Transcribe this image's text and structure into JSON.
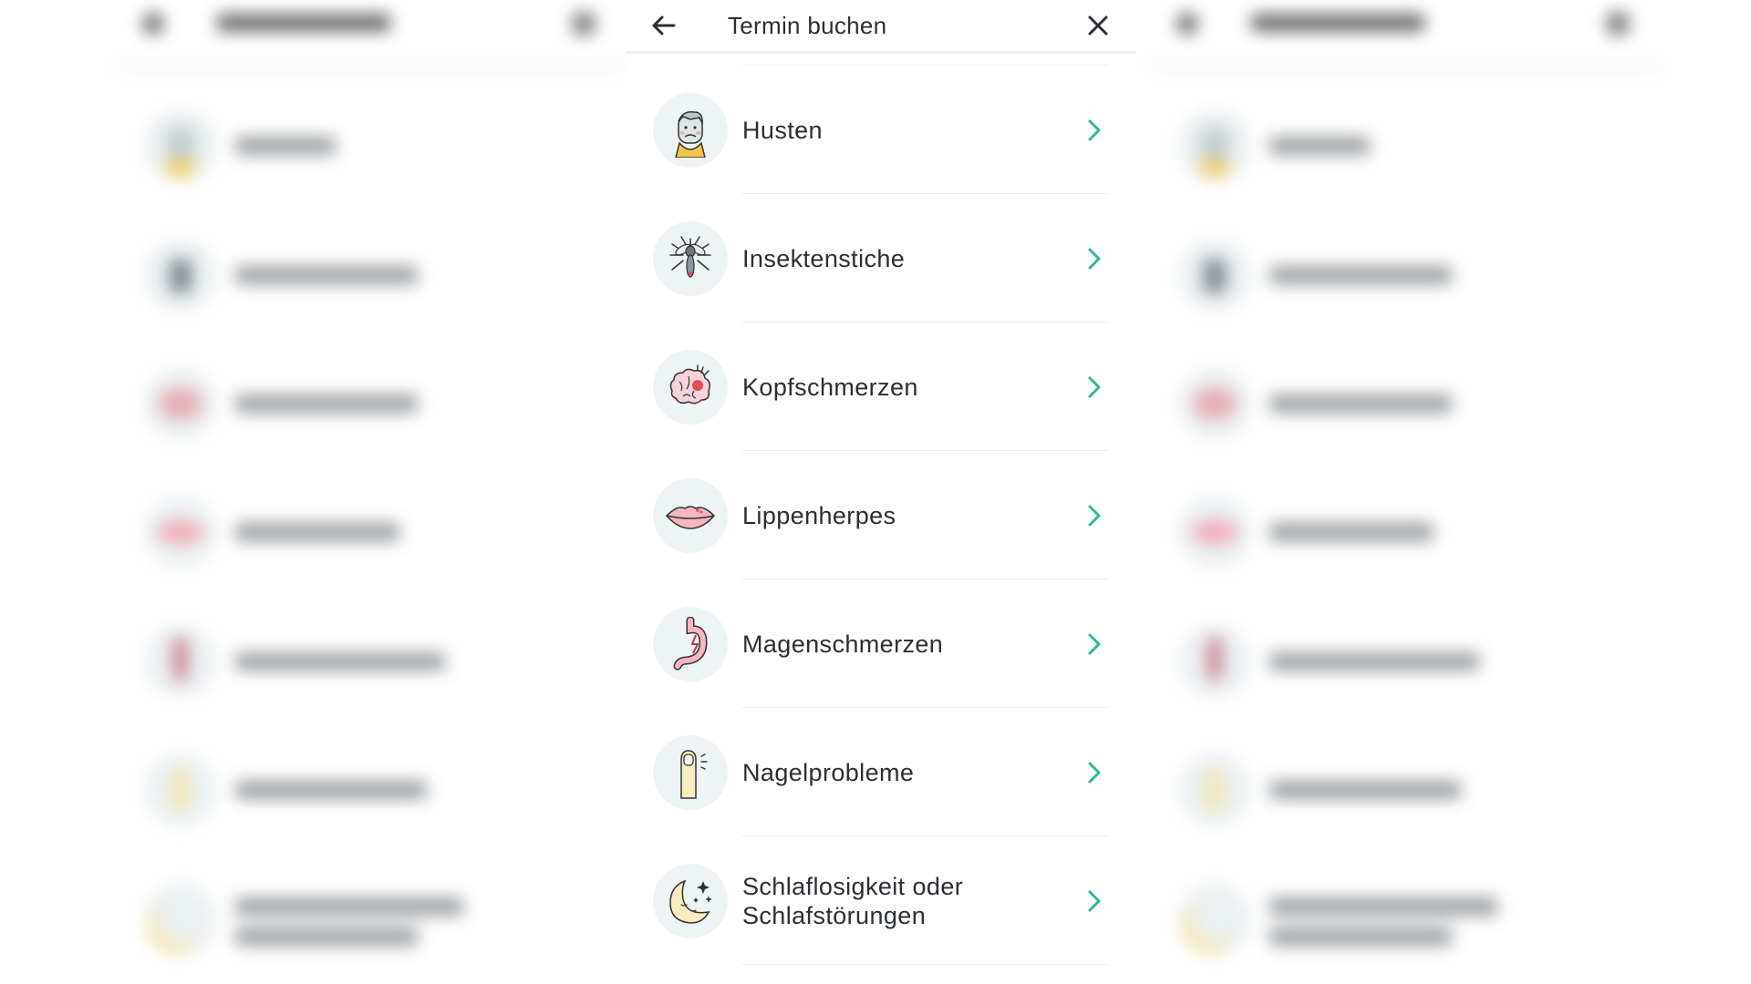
{
  "header": {
    "title": "Termin buchen",
    "back_icon": "arrow-left-icon",
    "close_icon": "close-icon"
  },
  "colors": {
    "accent": "#2fb5a3",
    "text": "#2b2f33",
    "divider": "#eceeef",
    "icon_bg": "#eef4f5"
  },
  "items": [
    {
      "label": "Husten",
      "icon": "coughing-person-icon"
    },
    {
      "label": "Insektenstiche",
      "icon": "mosquito-icon"
    },
    {
      "label": "Kopfschmerzen",
      "icon": "brain-headache-icon"
    },
    {
      "label": "Lippenherpes",
      "icon": "lips-icon"
    },
    {
      "label": "Magenschmerzen",
      "icon": "stomach-icon"
    },
    {
      "label": "Nagelprobleme",
      "icon": "finger-nail-icon"
    },
    {
      "label": "Schlaflosigkeit oder Schlafstörungen",
      "icon": "moon-stars-icon"
    }
  ]
}
